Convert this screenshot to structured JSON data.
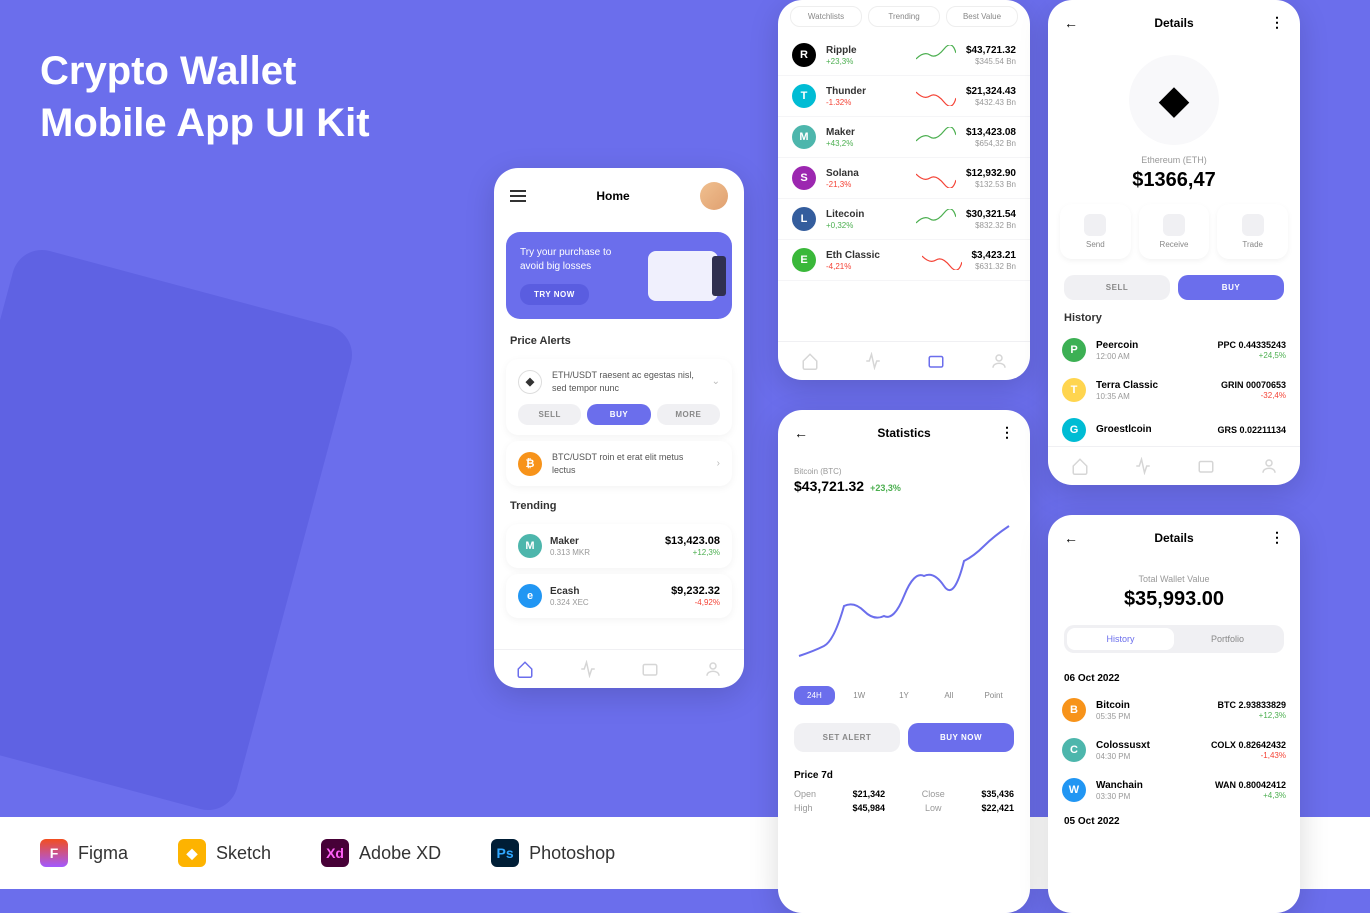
{
  "title": "Crypto Wallet\nMobile App UI Kit",
  "tools": [
    "Figma",
    "Sketch",
    "Adobe XD",
    "Photoshop"
  ],
  "home": {
    "title": "Home",
    "banner_text": "Try your purchase to avoid big losses",
    "banner_btn": "TRY NOW",
    "price_alerts": "Price Alerts",
    "alert1": "ETH/USDT raesent ac egestas nisl, sed tempor nunc",
    "alert2": "BTC/USDT roin et erat elit metus lectus",
    "sell": "SELL",
    "buy": "BUY",
    "more": "MORE",
    "trending": "Trending",
    "trend1": {
      "name": "Maker",
      "sub": "0.313 MKR",
      "price": "$13,423.08",
      "pct": "+12,3%"
    },
    "trend2": {
      "name": "Ecash",
      "sub": "0.324 XEC",
      "price": "$9,232.32",
      "pct": "-4,92%"
    }
  },
  "market": {
    "tabs": [
      "Watchlists",
      "Trending",
      "Best Value"
    ],
    "items": [
      {
        "name": "Ripple",
        "pct": "+23,3%",
        "price": "$43,721.32",
        "cap": "$345.54 Bn",
        "up": true
      },
      {
        "name": "Thunder",
        "pct": "-1.32%",
        "price": "$21,324.43",
        "cap": "$432.43 Bn",
        "up": false
      },
      {
        "name": "Maker",
        "pct": "+43,2%",
        "price": "$13,423.08",
        "cap": "$654,32 Bn",
        "up": true
      },
      {
        "name": "Solana",
        "pct": "-21,3%",
        "price": "$12,932.90",
        "cap": "$132.53 Bn",
        "up": false
      },
      {
        "name": "Litecoin",
        "pct": "+0,32%",
        "price": "$30,321.54",
        "cap": "$832.32 Bn",
        "up": true
      },
      {
        "name": "Eth Classic",
        "pct": "-4,21%",
        "price": "$3,423.21",
        "cap": "$631.32 Bn",
        "up": false
      }
    ]
  },
  "details": {
    "title": "Details",
    "coin": "Ethereum (ETH)",
    "price": "$1366,47",
    "send": "Send",
    "receive": "Receive",
    "trade": "Trade",
    "sell": "SELL",
    "buy": "BUY",
    "history": "History",
    "items": [
      {
        "name": "Peercoin",
        "time": "12:00 AM",
        "val": "PPC 0.44335243",
        "pct": "+24,5%",
        "up": true
      },
      {
        "name": "Terra Classic",
        "time": "10:35 AM",
        "val": "GRIN 00070653",
        "pct": "-32,4%",
        "up": false
      },
      {
        "name": "Groestlcoin",
        "time": "",
        "val": "GRS 0.02211134",
        "pct": "",
        "up": true
      }
    ]
  },
  "stats": {
    "title": "Statistics",
    "coin": "Bitcoin (BTC)",
    "price": "$43,721.32",
    "pct": "+23,3%",
    "tabs": [
      "24H",
      "1W",
      "1Y",
      "All",
      "Point"
    ],
    "set_alert": "SET ALERT",
    "buy_now": "BUY NOW",
    "p7d": "Price 7d",
    "open_l": "Open",
    "open": "$21,342",
    "close_l": "Close",
    "close": "$35,436",
    "high_l": "High",
    "high": "$45,984",
    "low_l": "Low",
    "low": "$22,421"
  },
  "wallet": {
    "title": "Details",
    "label": "Total Wallet Value",
    "value": "$35,993.00",
    "history": "History",
    "portfolio": "Portfolio",
    "date1": "06 Oct 2022",
    "date2": "05 Oct 2022",
    "items": [
      {
        "name": "Bitcoin",
        "time": "05:35 PM",
        "val": "BTC 2.93833829",
        "pct": "+12,3%",
        "up": true
      },
      {
        "name": "Colossusxt",
        "time": "04:30 PM",
        "val": "COLX 0.82642432",
        "pct": "-1,43%",
        "up": false
      },
      {
        "name": "Wanchain",
        "time": "03:30 PM",
        "val": "WAN 0.80042412",
        "pct": "+4,3%",
        "up": true
      }
    ]
  },
  "colors": {
    "purple": "#6b6eec",
    "up": "#4caf50",
    "down": "#f44336"
  }
}
